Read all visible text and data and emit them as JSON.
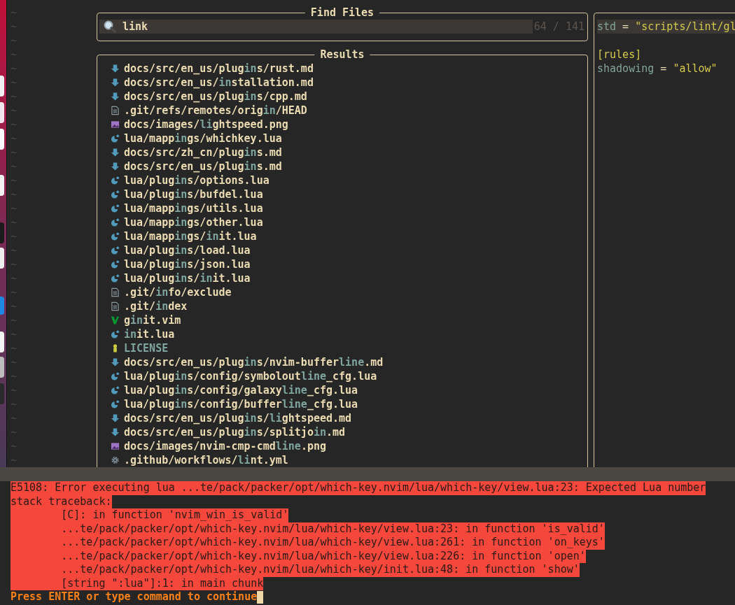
{
  "editor": {
    "empty_line_marks": [
      "~",
      "~",
      "~",
      "~",
      "~",
      "~",
      "~",
      "~",
      "~",
      "~",
      "~",
      "~",
      "~",
      "~",
      "~",
      "~",
      "~",
      "~",
      "~",
      "~",
      "~",
      "~",
      "~",
      "~",
      "~",
      "~",
      "~",
      "~",
      "~",
      "~",
      "~",
      "~",
      "~"
    ]
  },
  "prompt": {
    "title": "Find Files",
    "query": "link",
    "count": "64 / 141"
  },
  "results": {
    "title": "Results",
    "items": [
      {
        "kind": "markdown",
        "segments": [
          {
            "text": "docs/src/en_us/plug",
            "match": false
          },
          {
            "text": "in",
            "match": true
          },
          {
            "text": "s/rust.md",
            "match": false
          }
        ]
      },
      {
        "kind": "markdown",
        "segments": [
          {
            "text": "docs/src/en_us/",
            "match": false
          },
          {
            "text": "in",
            "match": true
          },
          {
            "text": "stallation.md",
            "match": false
          }
        ]
      },
      {
        "kind": "markdown",
        "segments": [
          {
            "text": "docs/src/en_us/plug",
            "match": false
          },
          {
            "text": "in",
            "match": true
          },
          {
            "text": "s/cpp.md",
            "match": false
          }
        ]
      },
      {
        "kind": "text",
        "segments": [
          {
            "text": ".git/refs/remotes/orig",
            "match": false
          },
          {
            "text": "in",
            "match": true
          },
          {
            "text": "/HEAD",
            "match": false
          }
        ]
      },
      {
        "kind": "image",
        "segments": [
          {
            "text": "docs/images/",
            "match": false
          },
          {
            "text": "li",
            "match": true
          },
          {
            "text": "ghtspeed.png",
            "match": false
          }
        ]
      },
      {
        "kind": "lua",
        "segments": [
          {
            "text": "lua/mapp",
            "match": false
          },
          {
            "text": "in",
            "match": true
          },
          {
            "text": "gs/whichkey.lua",
            "match": false
          }
        ]
      },
      {
        "kind": "markdown",
        "segments": [
          {
            "text": "docs/src/zh_cn/plug",
            "match": false
          },
          {
            "text": "in",
            "match": true
          },
          {
            "text": "s.md",
            "match": false
          }
        ]
      },
      {
        "kind": "markdown",
        "segments": [
          {
            "text": "docs/src/en_us/plug",
            "match": false
          },
          {
            "text": "in",
            "match": true
          },
          {
            "text": "s.md",
            "match": false
          }
        ]
      },
      {
        "kind": "lua",
        "segments": [
          {
            "text": "lua/plug",
            "match": false
          },
          {
            "text": "in",
            "match": true
          },
          {
            "text": "s/options.lua",
            "match": false
          }
        ]
      },
      {
        "kind": "lua",
        "segments": [
          {
            "text": "lua/plug",
            "match": false
          },
          {
            "text": "in",
            "match": true
          },
          {
            "text": "s/bufdel.lua",
            "match": false
          }
        ]
      },
      {
        "kind": "lua",
        "segments": [
          {
            "text": "lua/mapp",
            "match": false
          },
          {
            "text": "in",
            "match": true
          },
          {
            "text": "gs/utils.lua",
            "match": false
          }
        ]
      },
      {
        "kind": "lua",
        "segments": [
          {
            "text": "lua/mapp",
            "match": false
          },
          {
            "text": "in",
            "match": true
          },
          {
            "text": "gs/other.lua",
            "match": false
          }
        ]
      },
      {
        "kind": "lua",
        "segments": [
          {
            "text": "lua/mapp",
            "match": false
          },
          {
            "text": "in",
            "match": true
          },
          {
            "text": "gs/",
            "match": false
          },
          {
            "text": "in",
            "match": true
          },
          {
            "text": "it.lua",
            "match": false
          }
        ]
      },
      {
        "kind": "lua",
        "segments": [
          {
            "text": "lua/plug",
            "match": false
          },
          {
            "text": "in",
            "match": true
          },
          {
            "text": "s/load.lua",
            "match": false
          }
        ]
      },
      {
        "kind": "lua",
        "segments": [
          {
            "text": "lua/plug",
            "match": false
          },
          {
            "text": "in",
            "match": true
          },
          {
            "text": "s/json.lua",
            "match": false
          }
        ]
      },
      {
        "kind": "lua",
        "segments": [
          {
            "text": "lua/plug",
            "match": false
          },
          {
            "text": "in",
            "match": true
          },
          {
            "text": "s/",
            "match": false
          },
          {
            "text": "in",
            "match": true
          },
          {
            "text": "it.lua",
            "match": false
          }
        ]
      },
      {
        "kind": "text",
        "segments": [
          {
            "text": ".git/",
            "match": false
          },
          {
            "text": "in",
            "match": true
          },
          {
            "text": "fo/exclude",
            "match": false
          }
        ]
      },
      {
        "kind": "text",
        "segments": [
          {
            "text": ".git/",
            "match": false
          },
          {
            "text": "in",
            "match": true
          },
          {
            "text": "dex",
            "match": false
          }
        ]
      },
      {
        "kind": "vim",
        "segments": [
          {
            "text": "g",
            "match": false
          },
          {
            "text": "in",
            "match": true
          },
          {
            "text": "it.vim",
            "match": false
          }
        ]
      },
      {
        "kind": "lua",
        "segments": [
          {
            "text": "in",
            "match": true
          },
          {
            "text": "it.lua",
            "match": false
          }
        ]
      },
      {
        "kind": "license",
        "segments": [
          {
            "text": "LICENSE",
            "match": true
          }
        ]
      },
      {
        "kind": "markdown",
        "segments": [
          {
            "text": "docs/src/en_us/plug",
            "match": false
          },
          {
            "text": "in",
            "match": true
          },
          {
            "text": "s/nvim-buffer",
            "match": false
          },
          {
            "text": "line",
            "match": true
          },
          {
            "text": ".md",
            "match": false
          }
        ]
      },
      {
        "kind": "lua",
        "segments": [
          {
            "text": "lua/plug",
            "match": false
          },
          {
            "text": "in",
            "match": true
          },
          {
            "text": "s/config/symbolout",
            "match": false
          },
          {
            "text": "line",
            "match": true
          },
          {
            "text": "_cfg.lua",
            "match": false
          }
        ]
      },
      {
        "kind": "lua",
        "segments": [
          {
            "text": "lua/plug",
            "match": false
          },
          {
            "text": "in",
            "match": true
          },
          {
            "text": "s/config/galaxy",
            "match": false
          },
          {
            "text": "line",
            "match": true
          },
          {
            "text": "_cfg.lua",
            "match": false
          }
        ]
      },
      {
        "kind": "lua",
        "segments": [
          {
            "text": "lua/plug",
            "match": false
          },
          {
            "text": "in",
            "match": true
          },
          {
            "text": "s/config/buffer",
            "match": false
          },
          {
            "text": "line",
            "match": true
          },
          {
            "text": "_cfg.lua",
            "match": false
          }
        ]
      },
      {
        "kind": "markdown",
        "segments": [
          {
            "text": "docs/src/en_us/plug",
            "match": false
          },
          {
            "text": "in",
            "match": true
          },
          {
            "text": "s/",
            "match": false
          },
          {
            "text": "li",
            "match": true
          },
          {
            "text": "ghtspeed.md",
            "match": false
          }
        ]
      },
      {
        "kind": "markdown",
        "segments": [
          {
            "text": "docs/src/en_us/plug",
            "match": false
          },
          {
            "text": "in",
            "match": true
          },
          {
            "text": "s/splitjo",
            "match": false
          },
          {
            "text": "in",
            "match": true
          },
          {
            "text": ".md",
            "match": false
          }
        ]
      },
      {
        "kind": "image",
        "segments": [
          {
            "text": "docs/images/nvim-cmp-cmd",
            "match": false
          },
          {
            "text": "line",
            "match": true
          },
          {
            "text": ".png",
            "match": false
          }
        ]
      },
      {
        "kind": "config",
        "segments": [
          {
            "text": ".github/workflows/",
            "match": false
          },
          {
            "text": "li",
            "match": true
          },
          {
            "text": "nt.yml",
            "match": false
          }
        ]
      }
    ]
  },
  "preview": {
    "lines": [
      {
        "highlighted": true,
        "tokens": [
          {
            "text": "std",
            "kind": "key"
          },
          {
            "text": " = ",
            "kind": "op"
          },
          {
            "text": "\"scripts/lint/gl",
            "kind": "string"
          }
        ]
      },
      {
        "highlighted": false
      },
      {
        "highlighted": false,
        "tokens": [
          {
            "text": "[rules]",
            "kind": "section"
          }
        ]
      },
      {
        "highlighted": false,
        "tokens": [
          {
            "text": "shadowing",
            "kind": "key"
          },
          {
            "text": " = ",
            "kind": "op"
          },
          {
            "text": "\"allow\"",
            "kind": "string"
          }
        ]
      }
    ]
  },
  "messages": {
    "lines": [
      {
        "indent": false,
        "text": "E5108: Error executing lua ...te/pack/packer/opt/which-key.nvim/lua/which-key/view.lua:23: Expected Lua number"
      },
      {
        "indent": false,
        "text": "stack traceback:"
      },
      {
        "indent": true,
        "text": "[C]: in function 'nvim_win_is_valid'"
      },
      {
        "indent": true,
        "text": "...te/pack/packer/opt/which-key.nvim/lua/which-key/view.lua:23: in function 'is_valid'"
      },
      {
        "indent": true,
        "text": "...te/pack/packer/opt/which-key.nvim/lua/which-key/view.lua:261: in function 'on_keys'"
      },
      {
        "indent": true,
        "text": "...te/pack/packer/opt/which-key.nvim/lua/which-key/view.lua:226: in function 'open'"
      },
      {
        "indent": true,
        "text": "...te/pack/packer/opt/which-key.nvim/lua/which-key/init.lua:48: in function 'show'"
      },
      {
        "indent": true,
        "text": "[string \":lua\"]:1: in main chunk"
      }
    ],
    "prompt": "Press ENTER or type command to continue"
  }
}
